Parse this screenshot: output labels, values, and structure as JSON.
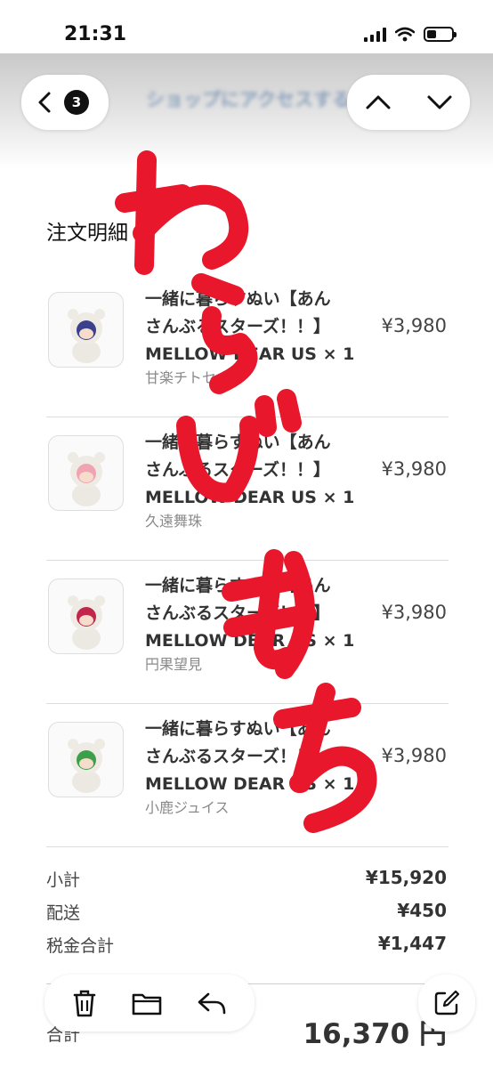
{
  "status_bar": {
    "time": "21:31"
  },
  "toolbar": {
    "back_badge_count": "3",
    "title": "ショップにアクセスする"
  },
  "order": {
    "section_title": "注文明細",
    "items": [
      {
        "name_line1": "一緒に暮らすぬい【あん",
        "name_line2": "さんぶるスターズ！！】",
        "name_line3": "MELLOW DEAR US × 1",
        "variant": "甘楽チトセ",
        "price": "¥3,980",
        "hair_color": "#3b3f8c"
      },
      {
        "name_line1": "一緒に暮らすぬい【あん",
        "name_line2": "さんぶるスターズ！！】",
        "name_line3": "MELLOW DEAR US × 1",
        "variant": "久遠舞珠",
        "price": "¥3,980",
        "hair_color": "#f1a3b2"
      },
      {
        "name_line1": "一緒に暮らすぬい【あん",
        "name_line2": "さんぶるスターズ！！】",
        "name_line3": "MELLOW DEAR US × 1",
        "variant": "円果望見",
        "price": "¥3,980",
        "hair_color": "#c2264a"
      },
      {
        "name_line1": "一緒に暮らすぬい【あん",
        "name_line2": "さんぶるスターズ！！】",
        "name_line3": "MELLOW DEAR US × 1",
        "variant": "小鹿ジュイス",
        "price": "¥3,980",
        "hair_color": "#3ca04a"
      }
    ],
    "summary": {
      "subtotal_label": "小計",
      "subtotal": "¥15,920",
      "shipping_label": "配送",
      "shipping": "¥450",
      "tax_label": "税金合計",
      "tax": "¥1,447",
      "total_label": "合計",
      "total": "16,370 円"
    }
  },
  "overlay": {
    "handwriting": "わらびもち",
    "color": "#e8172b"
  },
  "bottom_toolbar": {
    "delete_icon": "trash-icon",
    "move_icon": "folder-icon",
    "reply_icon": "reply-icon",
    "compose_icon": "compose-icon"
  }
}
